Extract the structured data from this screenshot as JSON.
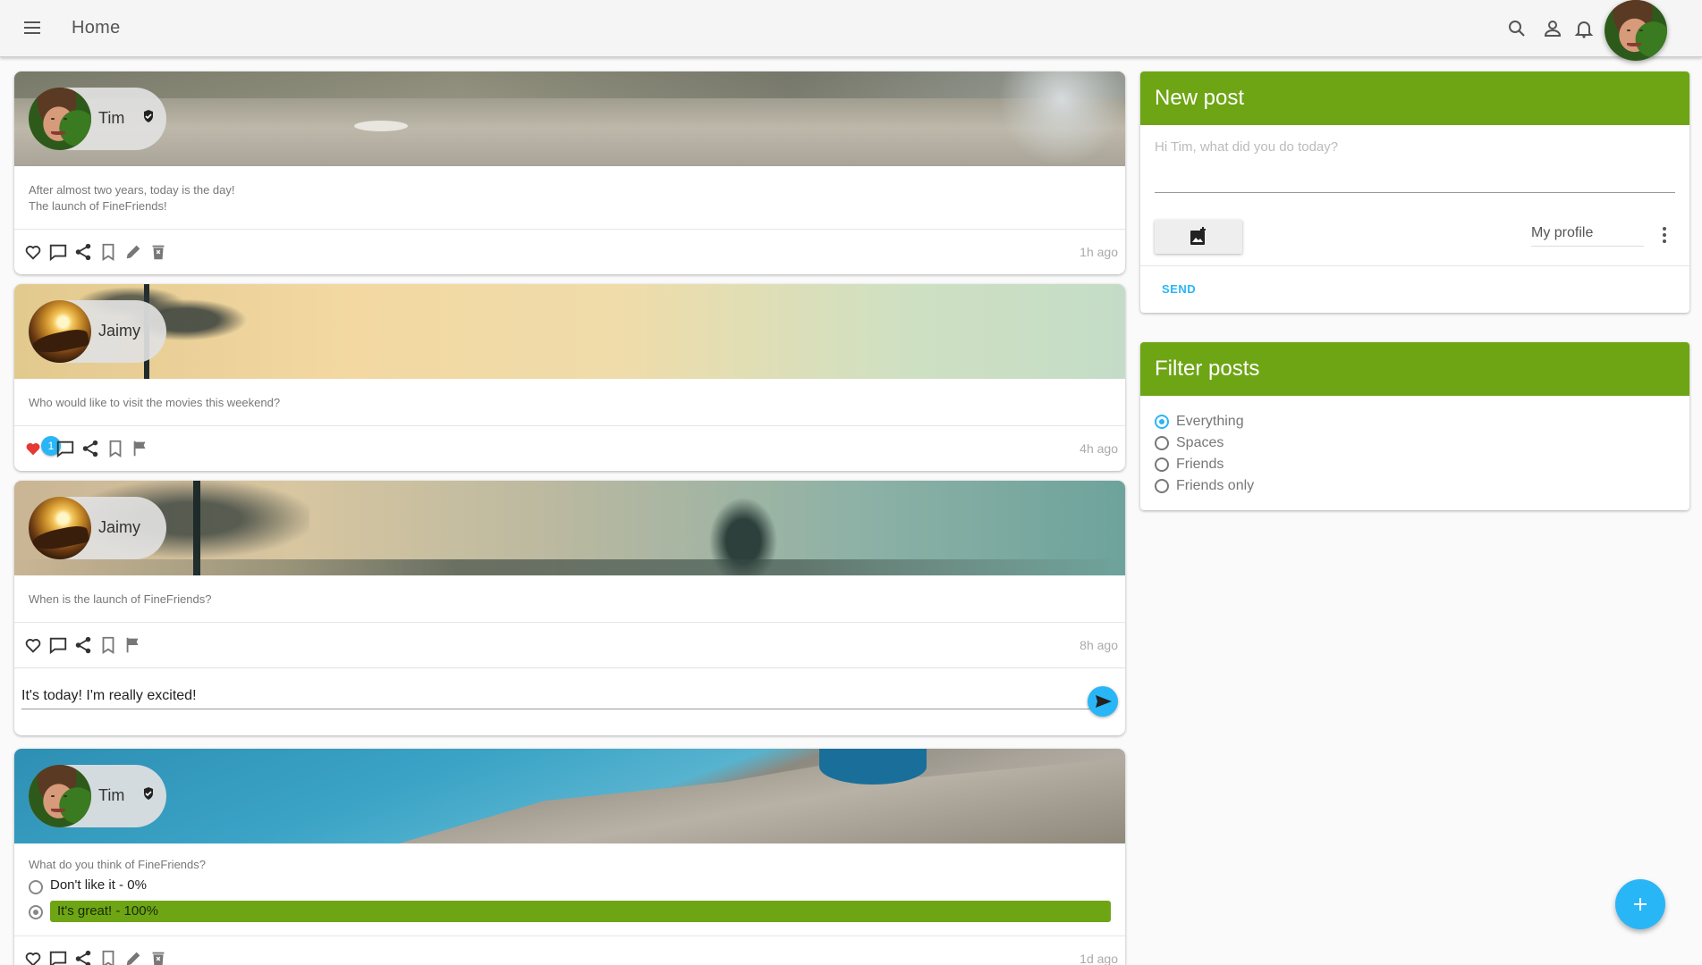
{
  "app": {
    "title": "Home"
  },
  "colors": {
    "accent_green": "#6ea515",
    "accent_blue": "#29b6f6",
    "like_red": "#e53935"
  },
  "header": {
    "icons": [
      "search-icon",
      "person-icon",
      "bell-icon"
    ]
  },
  "posts": [
    {
      "author": "Tim",
      "verified": true,
      "banner": "geyser-landscape",
      "text_lines": [
        "After almost two years, today is the day!",
        "The launch of FineFriends!"
      ],
      "time": "1h ago",
      "liked": false,
      "actions": [
        "heart-icon",
        "comment-icon",
        "share-icon",
        "bookmark-icon",
        "edit-icon",
        "delete-icon"
      ]
    },
    {
      "author": "Jaimy",
      "verified": false,
      "banner": "sunset-trees",
      "text_lines": [
        "Who would like to visit the movies this weekend?"
      ],
      "time": "4h ago",
      "liked": true,
      "like_count": "1",
      "actions": [
        "heart-icon",
        "comment-icon",
        "share-icon",
        "bookmark-icon",
        "flag-icon"
      ]
    },
    {
      "author": "Jaimy",
      "verified": false,
      "banner": "misty-forest",
      "text_lines": [
        "When is the launch of FineFriends?"
      ],
      "time": "8h ago",
      "liked": false,
      "actions": [
        "heart-icon",
        "comment-icon",
        "share-icon",
        "bookmark-icon",
        "flag-icon"
      ],
      "comment_value": "It's today! I'm really excited!"
    },
    {
      "author": "Tim",
      "verified": true,
      "banner": "hot-spring-pool",
      "poll": {
        "question": "What do you think of FineFriends?",
        "options": [
          {
            "label": "Don't like it - 0%",
            "selected": false,
            "percent": 0
          },
          {
            "label": "It's great! - 100%",
            "selected": true,
            "percent": 100
          }
        ]
      },
      "time": "1d ago",
      "liked": false,
      "actions": [
        "heart-icon",
        "comment-icon",
        "share-icon",
        "bookmark-icon",
        "edit-icon",
        "delete-icon"
      ]
    }
  ],
  "new_post": {
    "title": "New post",
    "placeholder": "Hi Tim, what did you do today?",
    "audience": "My profile",
    "send_label": "SEND"
  },
  "filter": {
    "title": "Filter posts",
    "options": [
      {
        "label": "Everything",
        "selected": true
      },
      {
        "label": "Spaces",
        "selected": false
      },
      {
        "label": "Friends",
        "selected": false
      },
      {
        "label": "Friends only",
        "selected": false
      }
    ]
  }
}
